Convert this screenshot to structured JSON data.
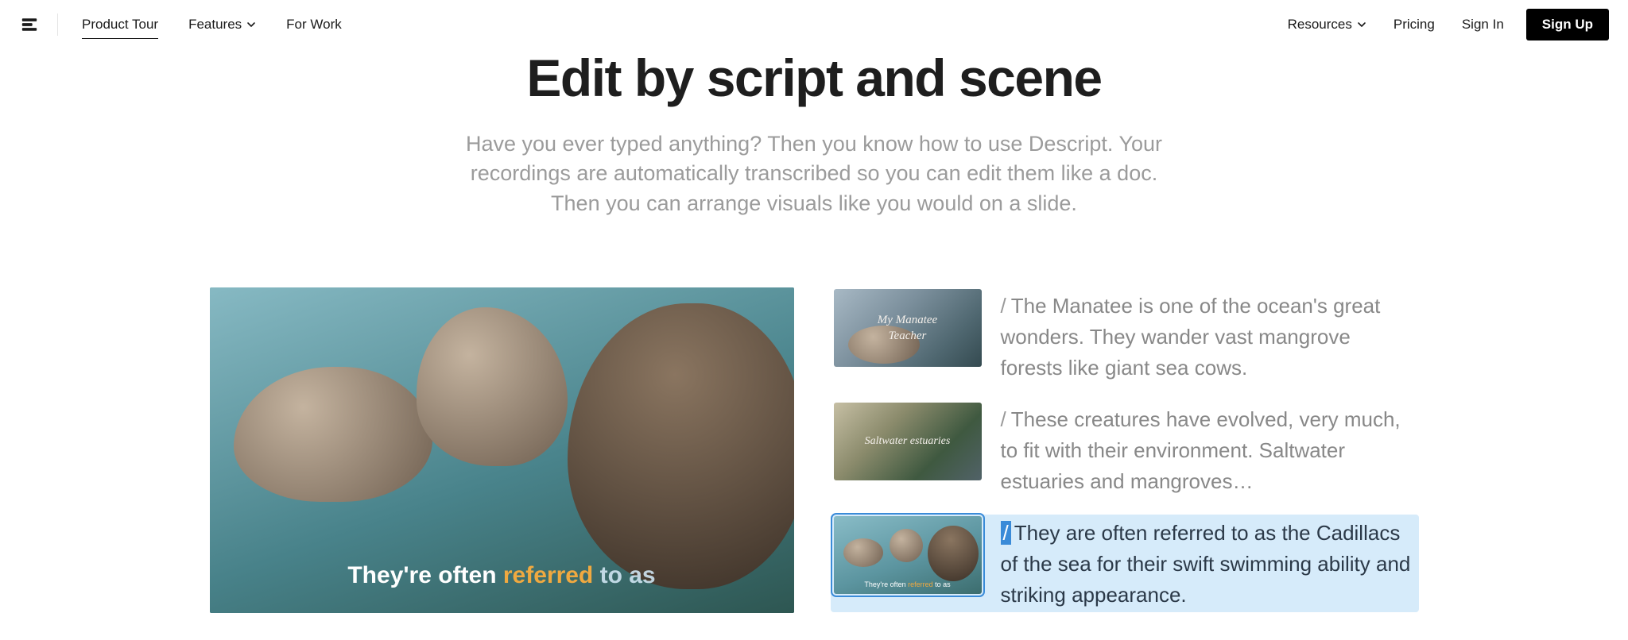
{
  "nav": {
    "left": {
      "product_tour": "Product Tour",
      "features": "Features",
      "for_work": "For Work"
    },
    "right": {
      "resources": "Resources",
      "pricing": "Pricing",
      "sign_in": "Sign In",
      "sign_up": "Sign Up"
    }
  },
  "hero": {
    "title": "Edit by script and scene",
    "subtitle": "Have you ever typed anything? Then you know how to use Descript. Your recordings are automatically transcribed so you can edit them like a doc. Then you can arrange visuals like you would on a slide."
  },
  "video": {
    "caption_pre": "They're often ",
    "caption_highlight": "referred",
    "caption_post": " to as"
  },
  "scenes": [
    {
      "thumb_overlay": "My Manatee\nTeacher",
      "text": "The Manatee is one of the ocean's great wonders. They wander vast mangrove forests like giant sea cows."
    },
    {
      "thumb_overlay": "Saltwater estuaries",
      "text": "These creatures have evolved, very much, to fit with their environment. Saltwater estuaries and mangroves…"
    },
    {
      "thumb_tiny_pre": "They're often ",
      "thumb_tiny_hi": "referred",
      "thumb_tiny_post": " to as",
      "text": "They are often referred to as the Cadillacs of the sea for their swift swimming ability and striking appearance."
    }
  ],
  "icons": {
    "logo": "descript-logo",
    "chevron": "chevron-down-icon"
  }
}
